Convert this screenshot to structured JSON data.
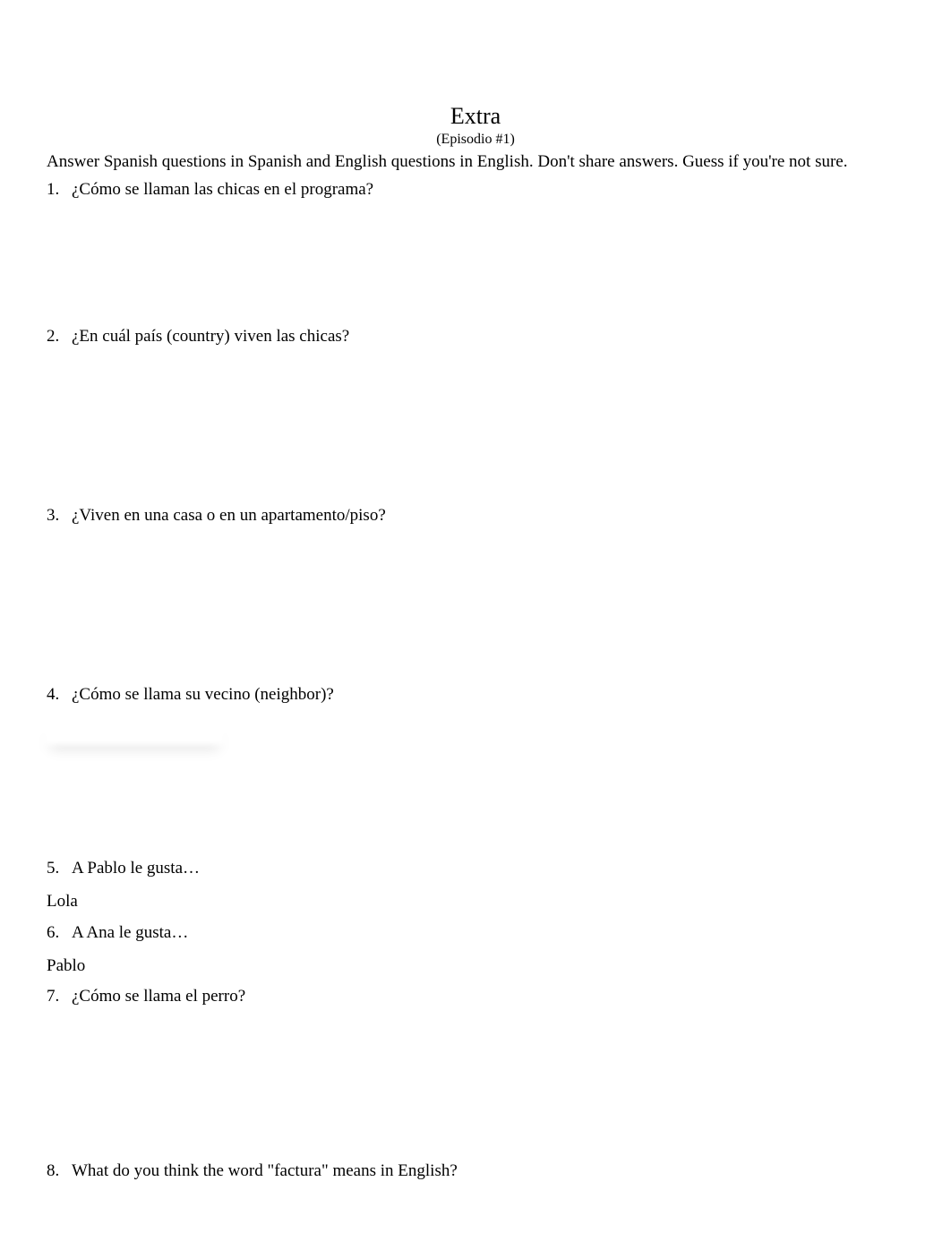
{
  "title": "Extra",
  "subtitle": "(Episodio #1)",
  "instructions": "Answer Spanish questions in Spanish and English questions in English. Don't share answers. Guess if you're not sure.",
  "questions": {
    "q1": {
      "num": "1.",
      "text": "¿Cómo se llaman las chicas en el programa?"
    },
    "q2": {
      "num": "2.",
      "text": "¿En cuál país (country) viven las chicas?"
    },
    "q3": {
      "num": "3.",
      "text": "¿Viven en una casa o en un apartamento/piso?"
    },
    "q4": {
      "num": "4.",
      "text": "¿Cómo se llama su vecino (neighbor)?"
    },
    "q5": {
      "num": "5.",
      "text": "A Pablo le gusta…"
    },
    "q6": {
      "num": "6.",
      "text": "A Ana le gusta…"
    },
    "q7": {
      "num": "7.",
      "text": "¿Cómo se llama el perro?"
    },
    "q8": {
      "num": "8.",
      "text": "What do you think the word \"factura\" means in English?"
    }
  },
  "answers": {
    "a5": "Lola",
    "a6": "Pablo"
  }
}
